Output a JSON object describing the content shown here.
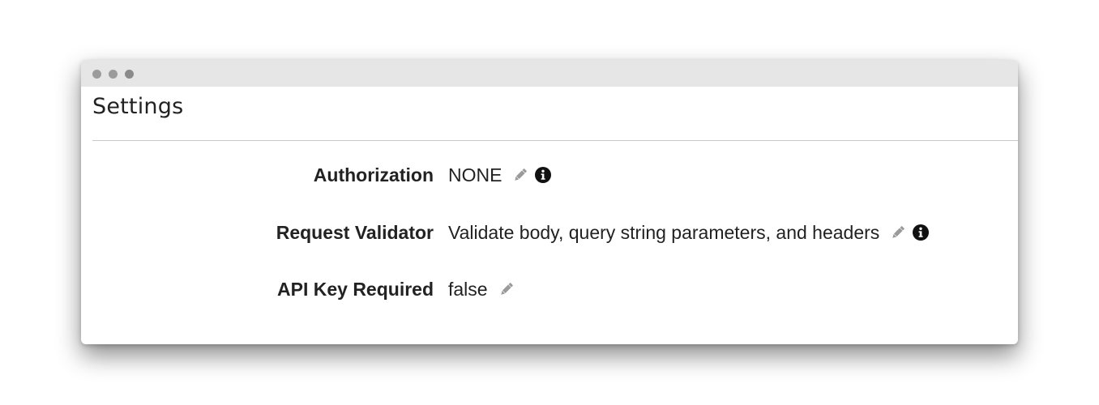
{
  "panel": {
    "title": "Settings"
  },
  "settings": [
    {
      "label": "Authorization",
      "value": "NONE",
      "icons": [
        "pencil-icon",
        "info-icon"
      ]
    },
    {
      "label": "Request Validator",
      "value": "Validate body, query string parameters, and headers",
      "icons": [
        "pencil-icon",
        "info-icon"
      ]
    },
    {
      "label": "API Key Required",
      "value": "false",
      "icons": [
        "pencil-icon"
      ]
    }
  ],
  "colors": {
    "titlebar": "#e6e6e6",
    "text": "#222222",
    "icon_pencil": "#9a9a9a",
    "icon_info": "#111111",
    "divider": "#c8c8c8"
  }
}
